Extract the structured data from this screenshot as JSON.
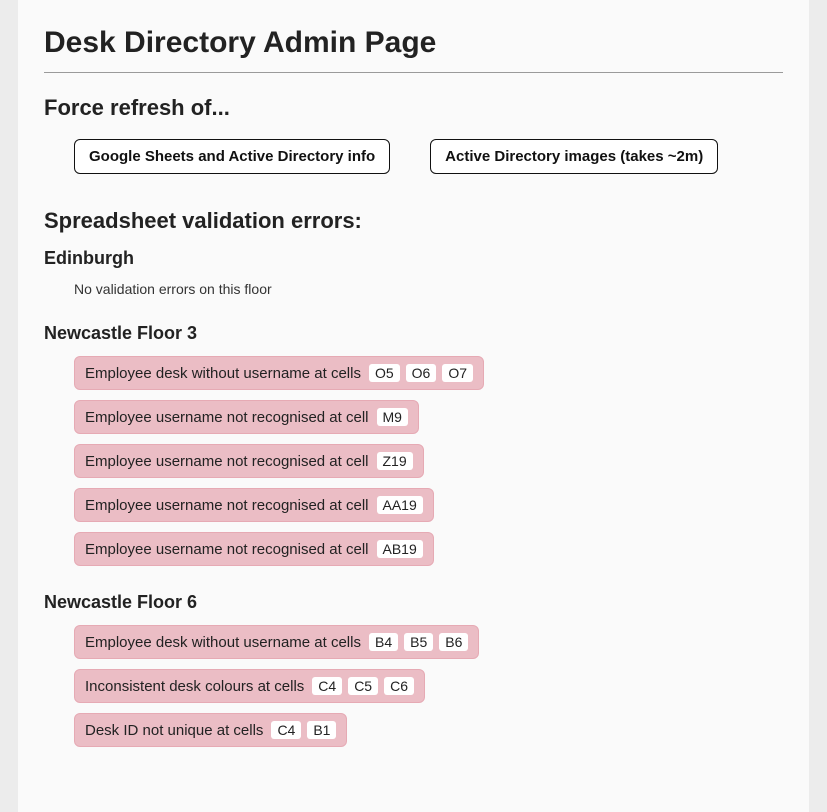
{
  "page_title": "Desk Directory Admin Page",
  "refresh": {
    "heading": "Force refresh of...",
    "buttons": [
      {
        "label": "Google Sheets and Active Directory info"
      },
      {
        "label": "Active Directory images (takes ~2m)"
      }
    ]
  },
  "validation": {
    "heading": "Spreadsheet validation errors:",
    "no_errors_text": "No validation errors on this floor",
    "floors": [
      {
        "name": "Edinburgh",
        "errors": []
      },
      {
        "name": "Newcastle Floor 3",
        "errors": [
          {
            "message": "Employee desk without username at cells",
            "cells": [
              "O5",
              "O6",
              "O7"
            ]
          },
          {
            "message": "Employee username not recognised at cell",
            "cells": [
              "M9"
            ]
          },
          {
            "message": "Employee username not recognised at cell",
            "cells": [
              "Z19"
            ]
          },
          {
            "message": "Employee username not recognised at cell",
            "cells": [
              "AA19"
            ]
          },
          {
            "message": "Employee username not recognised at cell",
            "cells": [
              "AB19"
            ]
          }
        ]
      },
      {
        "name": "Newcastle Floor 6",
        "errors": [
          {
            "message": "Employee desk without username at cells",
            "cells": [
              "B4",
              "B5",
              "B6"
            ]
          },
          {
            "message": "Inconsistent desk colours at cells",
            "cells": [
              "C4",
              "C5",
              "C6"
            ]
          },
          {
            "message": "Desk ID not unique at cells",
            "cells": [
              "C4",
              "B1"
            ]
          }
        ]
      }
    ]
  }
}
